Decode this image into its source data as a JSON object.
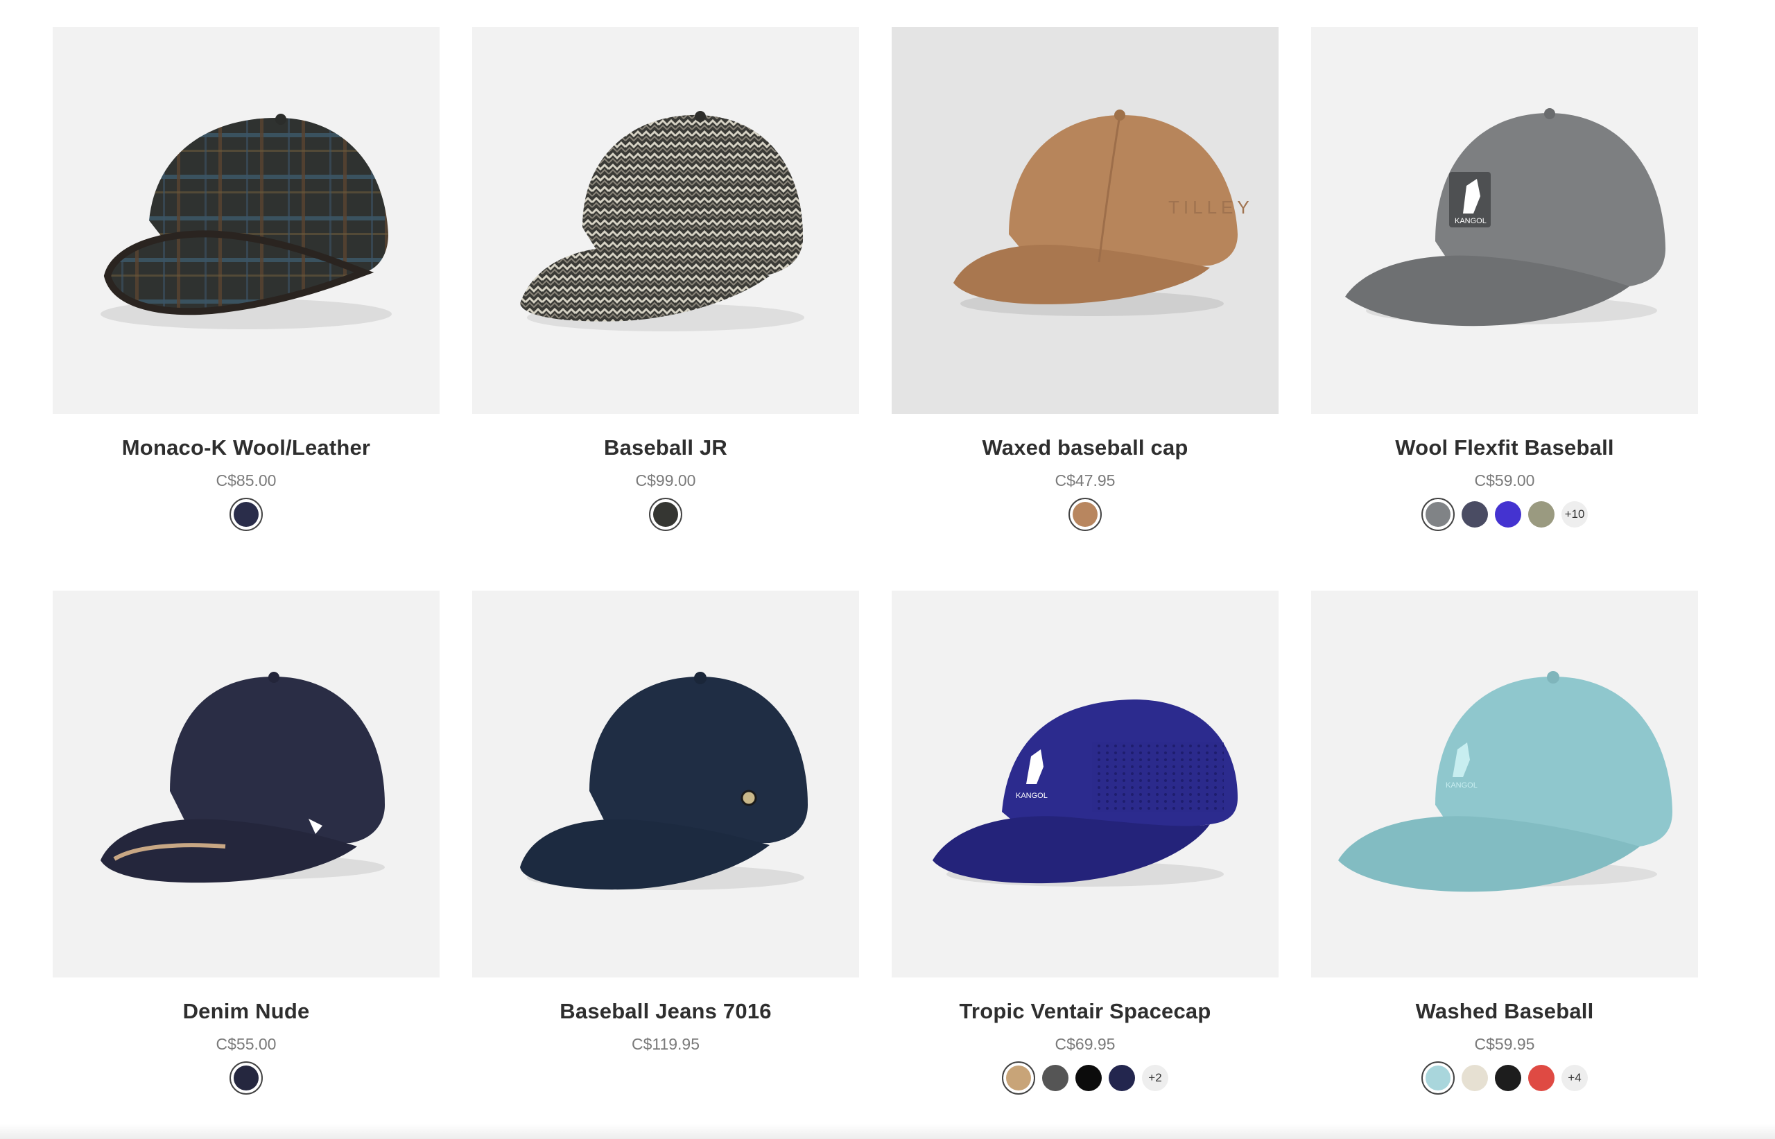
{
  "products": [
    {
      "title": "Monaco-K Wool/Leather",
      "price": "C$85.00",
      "image": "plaid-wool-cap-with-leather-brim",
      "swatches": [
        "#2a2d4a"
      ],
      "more": ""
    },
    {
      "title": "Baseball JR",
      "price": "C$99.00",
      "image": "herringbone-tweed-cap",
      "swatches": [
        "#353632"
      ],
      "more": ""
    },
    {
      "title": "Waxed baseball cap",
      "price": "C$47.95",
      "image": "tan-waxed-cap",
      "swatches": [
        "#b8865f"
      ],
      "more": ""
    },
    {
      "title": "Wool Flexfit Baseball",
      "price": "C$59.00",
      "image": "grey-flexfit-cap-with-kangaroo-logo",
      "swatches": [
        "#808386",
        "#4a4c63",
        "#4433d0",
        "#9a9a80"
      ],
      "more": "+10"
    },
    {
      "title": "Denim Nude",
      "price": "C$55.00",
      "image": "dark-denim-cap",
      "swatches": [
        "#25273f"
      ],
      "more": ""
    },
    {
      "title": "Baseball Jeans 7016",
      "price": "C$119.95",
      "image": "navy-denim-cap",
      "swatches": [],
      "more": ""
    },
    {
      "title": "Tropic Ventair Spacecap",
      "price": "C$69.95",
      "image": "royal-blue-mesh-cap-with-kangaroo-logo",
      "swatches": [
        "#c8a478",
        "#555555",
        "#0c0c0c",
        "#23264e"
      ],
      "more": "+2"
    },
    {
      "title": "Washed Baseball",
      "price": "C$59.95",
      "image": "aqua-washed-cap-with-kangaroo-logo",
      "swatches": [
        "#a9d6dc",
        "#e6e0d2",
        "#1d1d1d",
        "#df4a43"
      ],
      "more": "+4"
    }
  ]
}
